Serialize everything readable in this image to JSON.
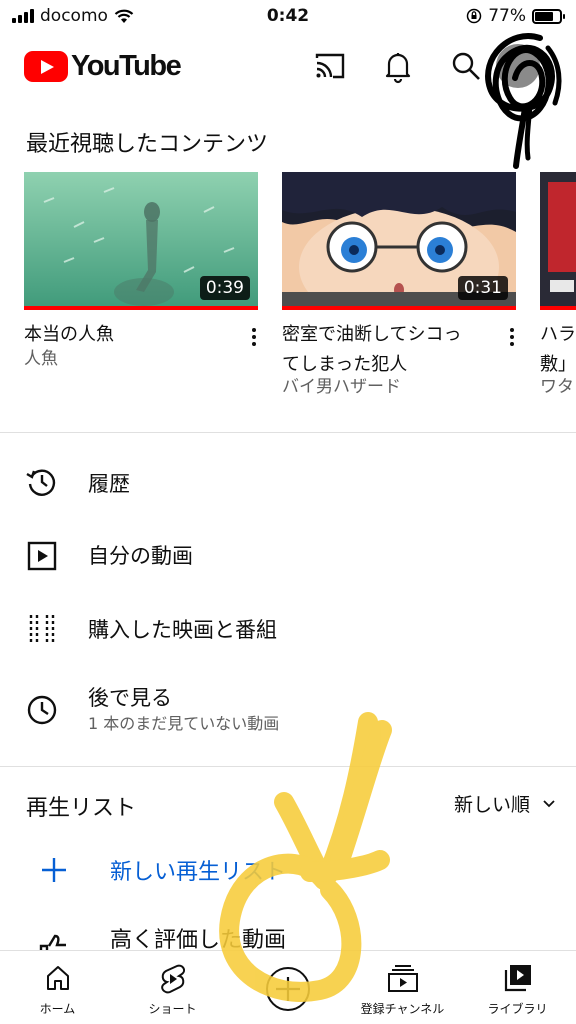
{
  "status_bar": {
    "carrier": "docomo",
    "time": "0:42",
    "battery": "77%",
    "battery_level": 0.77
  },
  "header": {
    "logo_text": "YouTube",
    "icons": [
      "cast-icon",
      "bell-icon",
      "search-icon",
      "avatar"
    ]
  },
  "recent": {
    "title": "最近視聴したコンテンツ",
    "items": [
      {
        "title": "本当の人魚",
        "channel": "人魚",
        "duration": "0:39"
      },
      {
        "title": "密室で油断してシコっ\nてしまった犯人",
        "channel": "バイ男ハザード",
        "duration": "0:31"
      },
      {
        "title": "ハラ\n敷」",
        "channel": "ワタ",
        "duration": ""
      }
    ]
  },
  "menu": [
    {
      "icon": "history-icon",
      "label": "履歴"
    },
    {
      "icon": "my-videos-icon",
      "label": "自分の動画"
    },
    {
      "icon": "purchases-icon",
      "label": "購入した映画と番組"
    },
    {
      "icon": "watch-later-icon",
      "label": "後で見る",
      "sub": "1 本のまだ見ていない動画"
    }
  ],
  "playlists": {
    "title": "再生リスト",
    "sort": "新しい順",
    "new_label": "新しい再生リスト",
    "liked_label": "高く評価した動画"
  },
  "bottom_nav": [
    {
      "icon": "home-icon",
      "label": "ホーム"
    },
    {
      "icon": "shorts-icon",
      "label": "ショート"
    },
    {
      "icon": "create-icon",
      "label": ""
    },
    {
      "icon": "subscriptions-icon",
      "label": "登録チャンネル"
    },
    {
      "icon": "library-icon",
      "label": "ライブラリ"
    }
  ],
  "colors": {
    "brand": "#ff0000",
    "link": "#065fd4",
    "secondary_text": "#606060"
  }
}
